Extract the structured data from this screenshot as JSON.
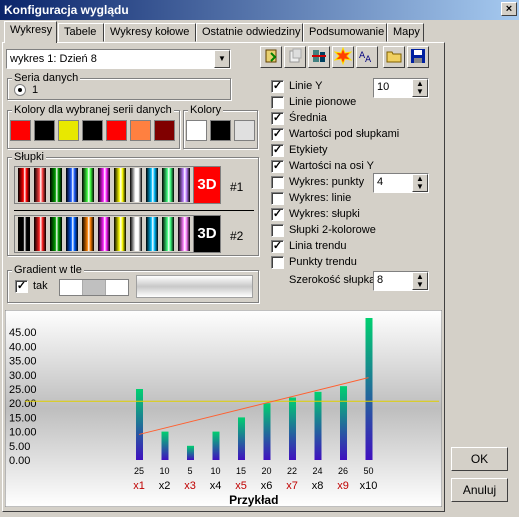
{
  "window": {
    "title": "Konfiguracja wyglądu",
    "close": "×"
  },
  "tabs": [
    "Wykresy",
    "Tabele",
    "Wykresy kołowe",
    "Ostatnie odwiedziny",
    "Podsumowanie",
    "Mapy"
  ],
  "chart_select": {
    "value": "wykres 1: Dzień 8"
  },
  "toolbar": [
    "paste-icon",
    "copy-icon",
    "swap-icon",
    "burst-icon",
    "font-icon",
    "open-folder-icon",
    "save-icon"
  ],
  "seria": {
    "label": "Seria danych",
    "radio": "1"
  },
  "kolory_serii": {
    "label": "Kolory dla wybranej serii danych",
    "colors": [
      "#ff0000",
      "#000000",
      "#e8e800",
      "#000000",
      "#ff0000",
      "#ff8040",
      "#800000"
    ]
  },
  "kolory": {
    "label": "Kolory",
    "colors": [
      "#ffffff",
      "#000000",
      "#e0e0e0"
    ]
  },
  "slupki": {
    "label": "Słupki",
    "row1_3d": "3D",
    "row1_id": "#1",
    "row2_3d": "3D",
    "row2_id": "#2"
  },
  "gradient": {
    "label": "Gradient w tle",
    "check": "✓",
    "tak": "tak"
  },
  "options": [
    {
      "label": "Linie Y",
      "checked": true
    },
    {
      "label": "Linie pionowe",
      "checked": false
    },
    {
      "label": "Średnia",
      "checked": true
    },
    {
      "label": "Wartości pod słupkami",
      "checked": true
    },
    {
      "label": "Etykiety",
      "checked": true
    },
    {
      "label": "Wartości na osi Y",
      "checked": true
    },
    {
      "label": "Wykres: punkty",
      "checked": false
    },
    {
      "label": "Wykres: linie",
      "checked": false
    },
    {
      "label": "Wykres: słupki",
      "checked": true
    },
    {
      "label": "Słupki 2-kolorowe",
      "checked": false
    },
    {
      "label": "Linia trendu",
      "checked": true
    },
    {
      "label": "Punkty trendu",
      "checked": false
    }
  ],
  "spin_linie": {
    "value": "10"
  },
  "spin_punkty": {
    "value": "4"
  },
  "szerokosc": {
    "label": "Szerokość słupka",
    "value": "8"
  },
  "buttons": {
    "ok": "OK",
    "cancel": "Anuluj"
  },
  "chart_data": {
    "type": "bar",
    "xlabel": "Przykład",
    "categories": [
      "x1",
      "x2",
      "x3",
      "x4",
      "x5",
      "x6",
      "x7",
      "x8",
      "x9",
      "x10"
    ],
    "category_colors": [
      "#c00000",
      "#000000",
      "#c00000",
      "#000000",
      "#c00000",
      "#000000",
      "#c00000",
      "#000000",
      "#c00000",
      "#000000"
    ],
    "values": [
      25,
      10,
      5,
      10,
      15,
      20,
      22,
      24,
      26,
      50
    ],
    "value_labels": [
      "25",
      "10",
      "5",
      "10",
      "15",
      "20",
      "22",
      "24",
      "26",
      "50"
    ],
    "yticks": [
      "45.00",
      "40.00",
      "35.00",
      "30.00",
      "25.00",
      "20.00",
      "15.00",
      "10.00",
      "5.00",
      "0.00"
    ],
    "ylim": [
      0,
      50
    ],
    "average": 20.7,
    "trend": [
      [
        1,
        9
      ],
      [
        10,
        29
      ]
    ],
    "colors": {
      "bar_top": "#00d070",
      "bar_bottom": "#4010c0",
      "average": "#e0d000",
      "trend": "#ff6030"
    }
  }
}
